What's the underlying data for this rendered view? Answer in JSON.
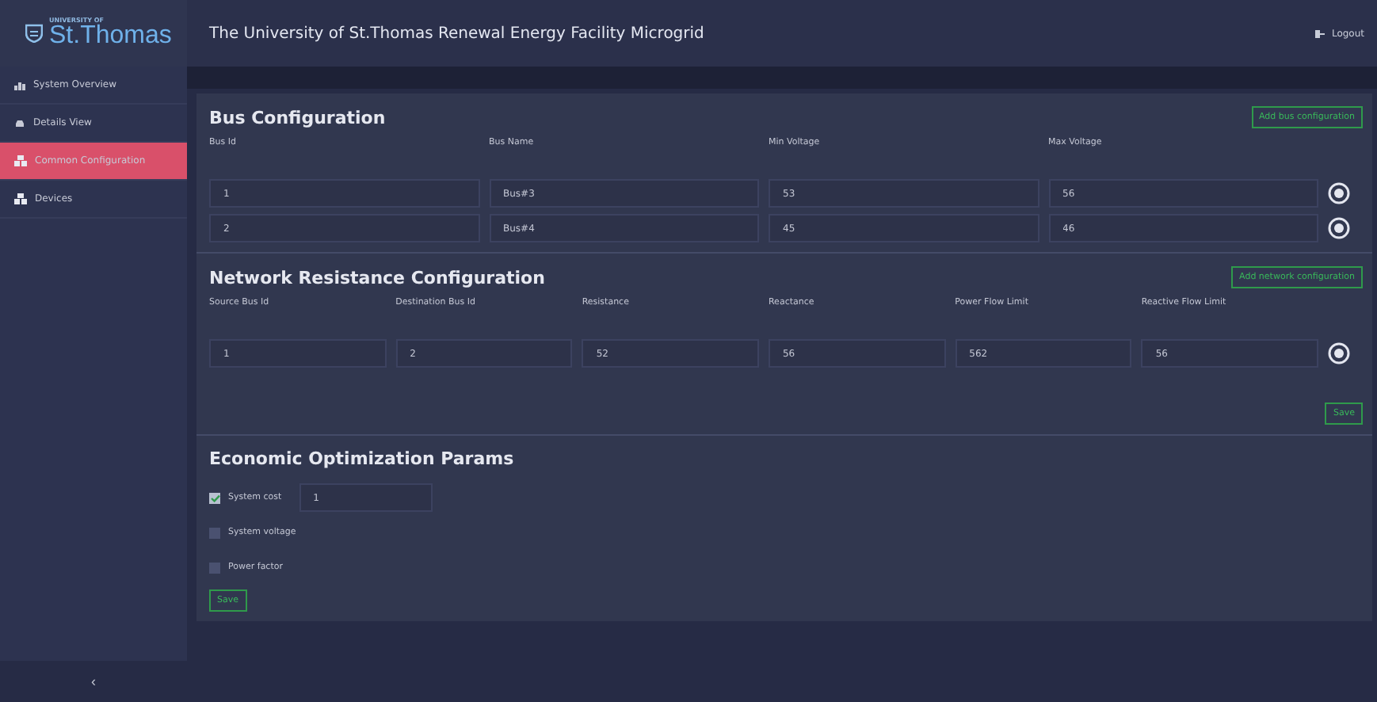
{
  "logo": {
    "small": "UNIVERSITY OF",
    "name": "St.Thomas"
  },
  "header": {
    "title": "The University of St.Thomas Renewal Energy Facility Microgrid",
    "logout": "Logout"
  },
  "sidebar": {
    "items": [
      {
        "label": "System Overview",
        "kind": "chart",
        "selected": false
      },
      {
        "label": "Details View",
        "kind": "car",
        "selected": false
      },
      {
        "label": "Common Configuration",
        "kind": "cubes",
        "selected": true
      },
      {
        "label": "Devices",
        "kind": "cubes",
        "selected": false
      }
    ],
    "collapse": "‹"
  },
  "bus_configuration": {
    "title": "Bus Configuration",
    "add_button": "Add bus configuration",
    "columns": [
      "Bus Id",
      "Bus Name",
      "Min Voltage",
      "Max Voltage"
    ],
    "rows": [
      [
        "1",
        "Bus#3",
        "53",
        "56"
      ],
      [
        "2",
        "Bus#4",
        "45",
        "46"
      ]
    ]
  },
  "network_resistance": {
    "title": "Network Resistance Configuration",
    "add_button": "Add network configuration",
    "columns": [
      "Source Bus Id",
      "Destination Bus Id",
      "Resistance",
      "Reactance",
      "Power Flow Limit",
      "Reactive Flow Limit"
    ],
    "rows": [
      [
        "1",
        "2",
        "52",
        "56",
        "562",
        "56"
      ]
    ],
    "save_button": "Save"
  },
  "economic_params": {
    "title": "Economic Optimization Params",
    "options": [
      {
        "label": "System cost",
        "checked": true,
        "value": "1"
      },
      {
        "label": "System voltage",
        "checked": false
      },
      {
        "label": "Power factor",
        "checked": false
      }
    ],
    "save_button": "Save"
  }
}
